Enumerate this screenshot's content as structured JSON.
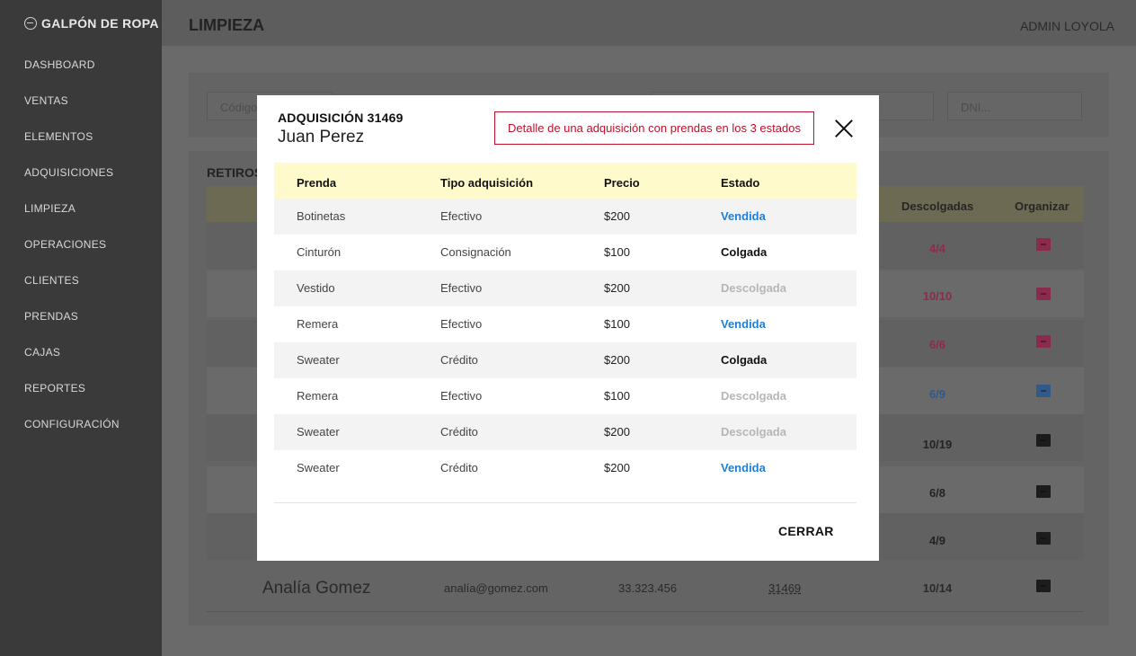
{
  "brand": "GALPÓN DE ROPA",
  "nav": [
    "DASHBOARD",
    "VENTAS",
    "ELEMENTOS",
    "ADQUISICIONES",
    "LIMPIEZA",
    "OPERACIONES",
    "CLIENTES",
    "PRENDAS",
    "CAJAS",
    "REPORTES",
    "CONFIGURACIÓN"
  ],
  "header": {
    "title": "LIMPIEZA",
    "user": "ADMIN LOYOLA"
  },
  "filters": {
    "code_placeholder": "Código",
    "dni_placeholder": "DNI..."
  },
  "list": {
    "title": "RETIROS",
    "columns": {
      "descolgadas": "Descolgadas",
      "organizar": "Organizar"
    },
    "counts": [
      "4/4",
      "10/10",
      "6/6",
      "6/9",
      "10/19",
      "6/8",
      "4/9",
      "10/14"
    ],
    "last_row": {
      "name": "Analía Gomez",
      "email": "analía@gomez.com",
      "dni": "33.323.456",
      "acquisition": "31469",
      "count": "10/14"
    }
  },
  "modal": {
    "title": "ADQUISICIÓN 31469",
    "subtitle": "Juan Perez",
    "note": "Detalle de una adquisición con prendas en los 3 estados",
    "columns": {
      "prenda": "Prenda",
      "tipo": "Tipo adquisición",
      "precio": "Precio",
      "estado": "Estado"
    },
    "rows": [
      {
        "prenda": "Botinetas",
        "tipo": "Efectivo",
        "precio": "$200",
        "estado": "Vendida"
      },
      {
        "prenda": "Cinturón",
        "tipo": "Consignación",
        "precio": "$100",
        "estado": "Colgada"
      },
      {
        "prenda": "Vestido",
        "tipo": "Efectivo",
        "precio": "$200",
        "estado": "Descolgada"
      },
      {
        "prenda": "Remera",
        "tipo": "Efectivo",
        "precio": "$100",
        "estado": "Vendida"
      },
      {
        "prenda": "Sweater",
        "tipo": "Crédito",
        "precio": "$200",
        "estado": "Colgada"
      },
      {
        "prenda": "Remera",
        "tipo": "Efectivo",
        "precio": "$100",
        "estado": "Descolgada"
      },
      {
        "prenda": "Sweater",
        "tipo": "Crédito",
        "precio": "$200",
        "estado": "Descolgada"
      },
      {
        "prenda": "Sweater",
        "tipo": "Crédito",
        "precio": "$200",
        "estado": "Vendida"
      }
    ],
    "close_label": "CERRAR"
  },
  "colors": {
    "vendida": "#1e7fd8",
    "colgada": "#111111",
    "descolgada": "#b6b6b6",
    "alert": "#c0102a",
    "header_bg": "#fffacc"
  }
}
